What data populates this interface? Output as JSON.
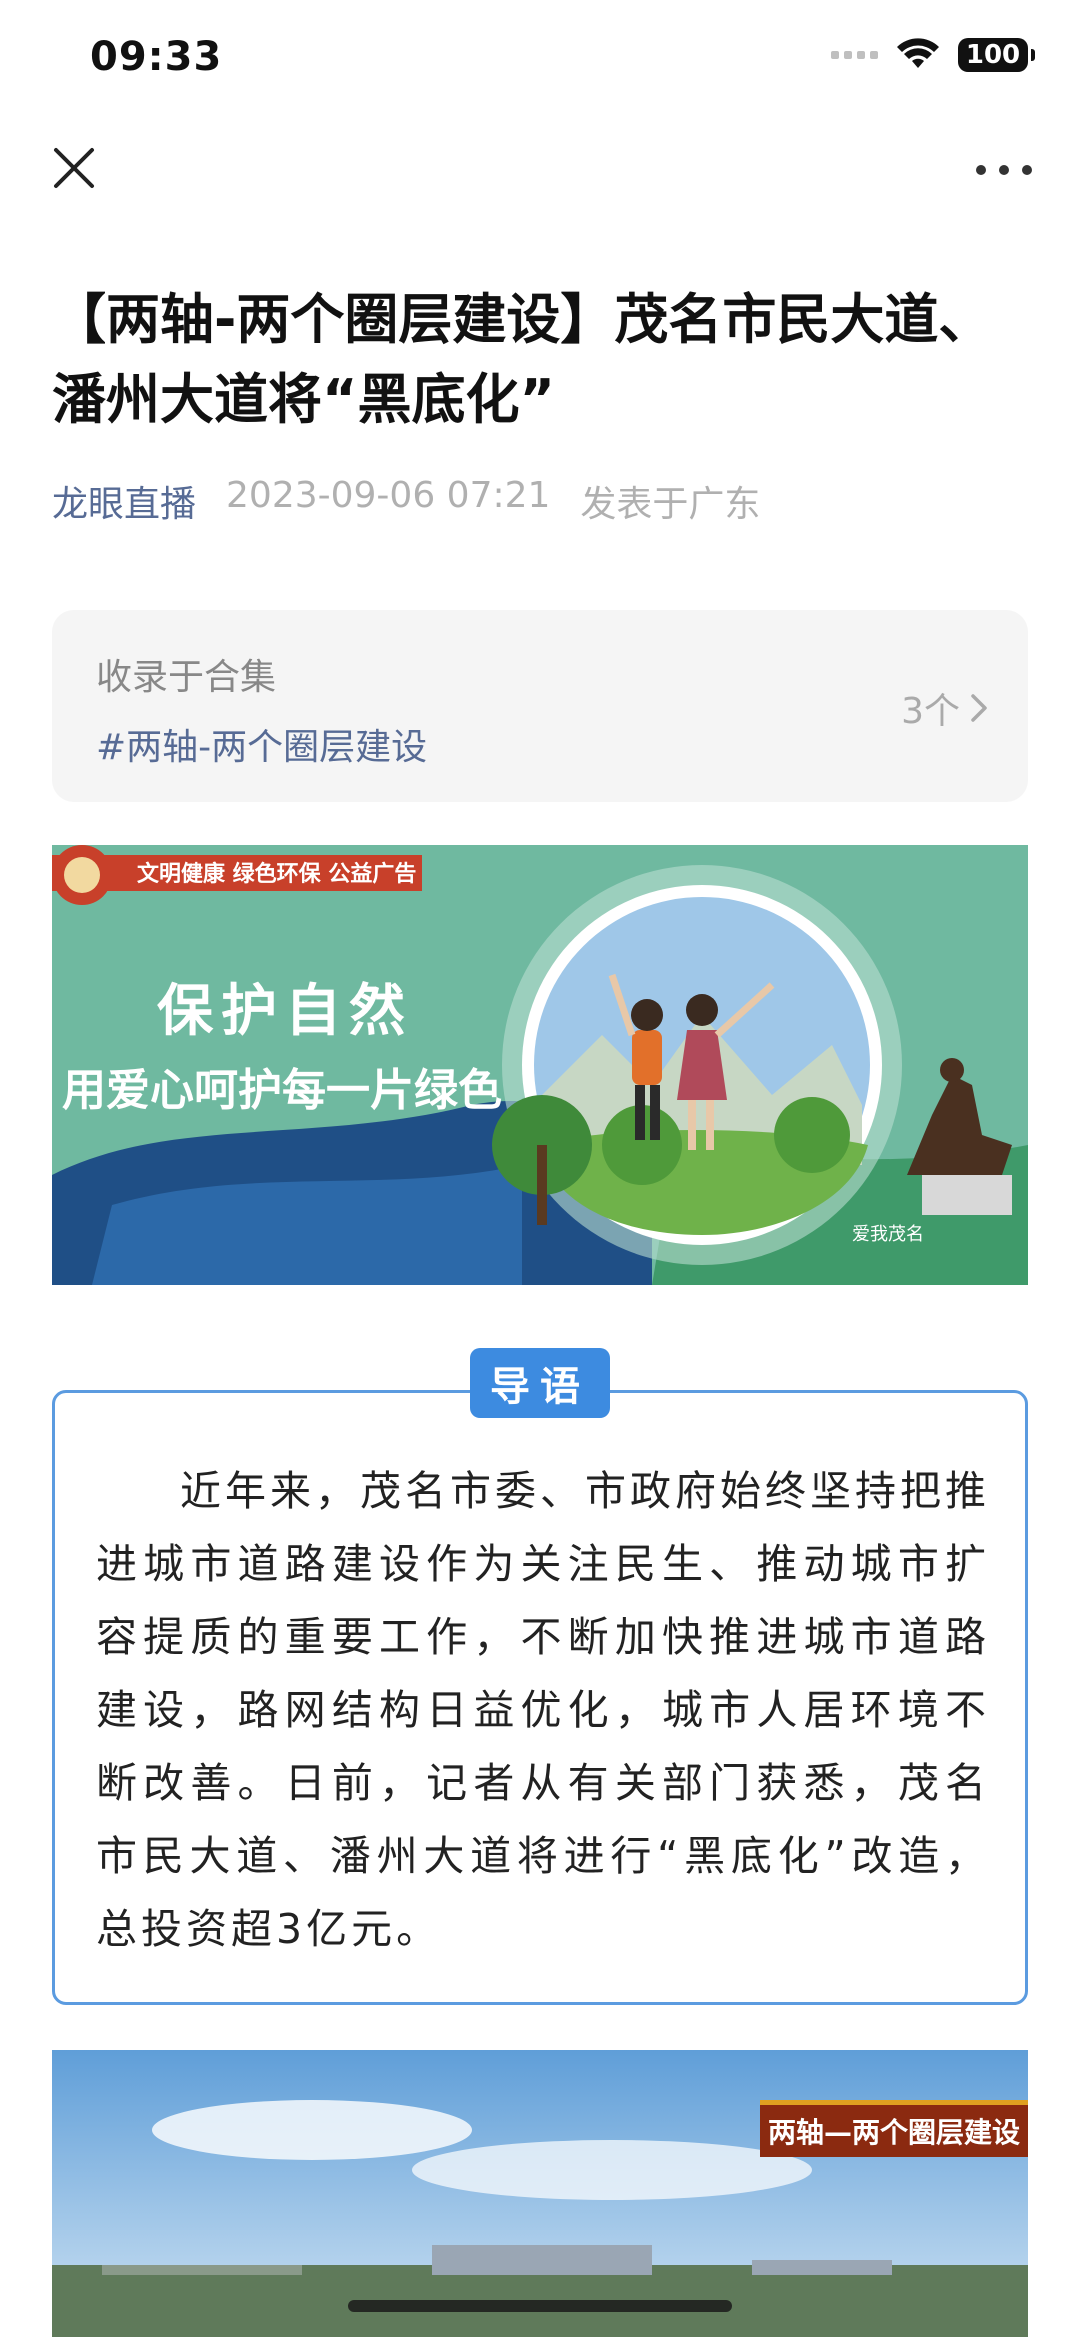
{
  "status_bar": {
    "time": "09:33",
    "battery": "100"
  },
  "article": {
    "title": "【两轴-两个圈层建设】茂名市民大道、潘州大道将“黑底化”",
    "source": "龙眼直播",
    "datetime": "2023-09-06 07:21",
    "location": "发表于广东"
  },
  "collection": {
    "label": "收录于合集",
    "tag": "#两轴-两个圈层建设",
    "count": "3个"
  },
  "banner": {
    "ribbon": "文明健康 绿色环保 公益广告",
    "headline": "保护自然",
    "subline": "用爱心呵护每一片绿色",
    "corner_text": "爱我茂名"
  },
  "intro": {
    "badge": "导语",
    "text": "近年来，茂名市委、市政府始终坚持把推进城市道路建设作为关注民生、推动城市扩容提质的重要工作，不断加快推进城市道路建设，路网结构日益优化，城市人居环境不断改善。日前，记者从有关部门获悉，茂名市民大道、潘州大道将进行“黑底化”改造，总投资超3亿元。"
  },
  "video": {
    "caption": "两轴—两个圈层建设"
  },
  "colors": {
    "link": "#576b95",
    "accent": "#3d8be0",
    "banner_bg": "#6fb9a0"
  },
  "icons": [
    "close-icon",
    "more-icon",
    "chevron-right-icon",
    "wifi-icon",
    "signal-icon",
    "battery-icon"
  ]
}
